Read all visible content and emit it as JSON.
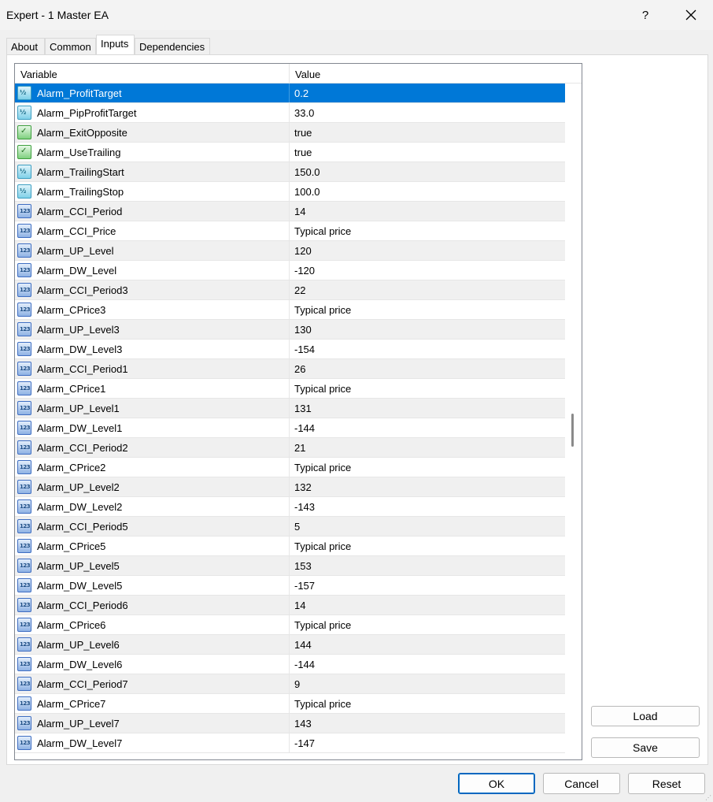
{
  "window": {
    "title": "Expert - 1 Master EA",
    "help_label": "?"
  },
  "tabs": [
    {
      "label": "About"
    },
    {
      "label": "Common"
    },
    {
      "label": "Inputs"
    },
    {
      "label": "Dependencies"
    }
  ],
  "grid": {
    "col_variable": "Variable",
    "col_value": "Value",
    "rows": [
      {
        "name": "Alarm_ProfitTarget",
        "value": "0.2",
        "type": "double",
        "selected": true
      },
      {
        "name": "Alarm_PipProfitTarget",
        "value": "33.0",
        "type": "double"
      },
      {
        "name": "Alarm_ExitOpposite",
        "value": "true",
        "type": "bool"
      },
      {
        "name": "Alarm_UseTrailing",
        "value": "true",
        "type": "bool"
      },
      {
        "name": "Alarm_TrailingStart",
        "value": "150.0",
        "type": "double"
      },
      {
        "name": "Alarm_TrailingStop",
        "value": "100.0",
        "type": "double"
      },
      {
        "name": "Alarm_CCI_Period",
        "value": "14",
        "type": "int"
      },
      {
        "name": "Alarm_CCI_Price",
        "value": "Typical price",
        "type": "int"
      },
      {
        "name": "Alarm_UP_Level",
        "value": "120",
        "type": "int"
      },
      {
        "name": "Alarm_DW_Level",
        "value": "-120",
        "type": "int"
      },
      {
        "name": "Alarm_CCI_Period3",
        "value": "22",
        "type": "int"
      },
      {
        "name": "Alarm_CPrice3",
        "value": "Typical price",
        "type": "int"
      },
      {
        "name": "Alarm_UP_Level3",
        "value": "130",
        "type": "int"
      },
      {
        "name": "Alarm_DW_Level3",
        "value": "-154",
        "type": "int"
      },
      {
        "name": "Alarm_CCI_Period1",
        "value": "26",
        "type": "int"
      },
      {
        "name": "Alarm_CPrice1",
        "value": "Typical price",
        "type": "int"
      },
      {
        "name": "Alarm_UP_Level1",
        "value": "131",
        "type": "int"
      },
      {
        "name": "Alarm_DW_Level1",
        "value": "-144",
        "type": "int"
      },
      {
        "name": "Alarm_CCI_Period2",
        "value": "21",
        "type": "int"
      },
      {
        "name": "Alarm_CPrice2",
        "value": "Typical price",
        "type": "int"
      },
      {
        "name": "Alarm_UP_Level2",
        "value": "132",
        "type": "int"
      },
      {
        "name": "Alarm_DW_Level2",
        "value": "-143",
        "type": "int"
      },
      {
        "name": "Alarm_CCI_Period5",
        "value": "5",
        "type": "int"
      },
      {
        "name": "Alarm_CPrice5",
        "value": "Typical price",
        "type": "int"
      },
      {
        "name": "Alarm_UP_Level5",
        "value": "153",
        "type": "int"
      },
      {
        "name": "Alarm_DW_Level5",
        "value": "-157",
        "type": "int"
      },
      {
        "name": "Alarm_CCI_Period6",
        "value": "14",
        "type": "int"
      },
      {
        "name": "Alarm_CPrice6",
        "value": "Typical price",
        "type": "int"
      },
      {
        "name": "Alarm_UP_Level6",
        "value": "144",
        "type": "int"
      },
      {
        "name": "Alarm_DW_Level6",
        "value": "-144",
        "type": "int"
      },
      {
        "name": "Alarm_CCI_Period7",
        "value": "9",
        "type": "int"
      },
      {
        "name": "Alarm_CPrice7",
        "value": "Typical price",
        "type": "int"
      },
      {
        "name": "Alarm_UP_Level7",
        "value": "143",
        "type": "int"
      },
      {
        "name": "Alarm_DW_Level7",
        "value": "-147",
        "type": "int"
      }
    ],
    "icon_text": {
      "double": "½",
      "bool": "✓",
      "int": "123"
    }
  },
  "side_buttons": {
    "load_label": "Load",
    "save_label": "Save"
  },
  "footer": {
    "ok_label": "OK",
    "cancel_label": "Cancel",
    "reset_label": "Reset"
  },
  "colors": {
    "selection": "#0078d7",
    "row_alt": "#f0f0f0",
    "primary_border": "#0067c0"
  }
}
